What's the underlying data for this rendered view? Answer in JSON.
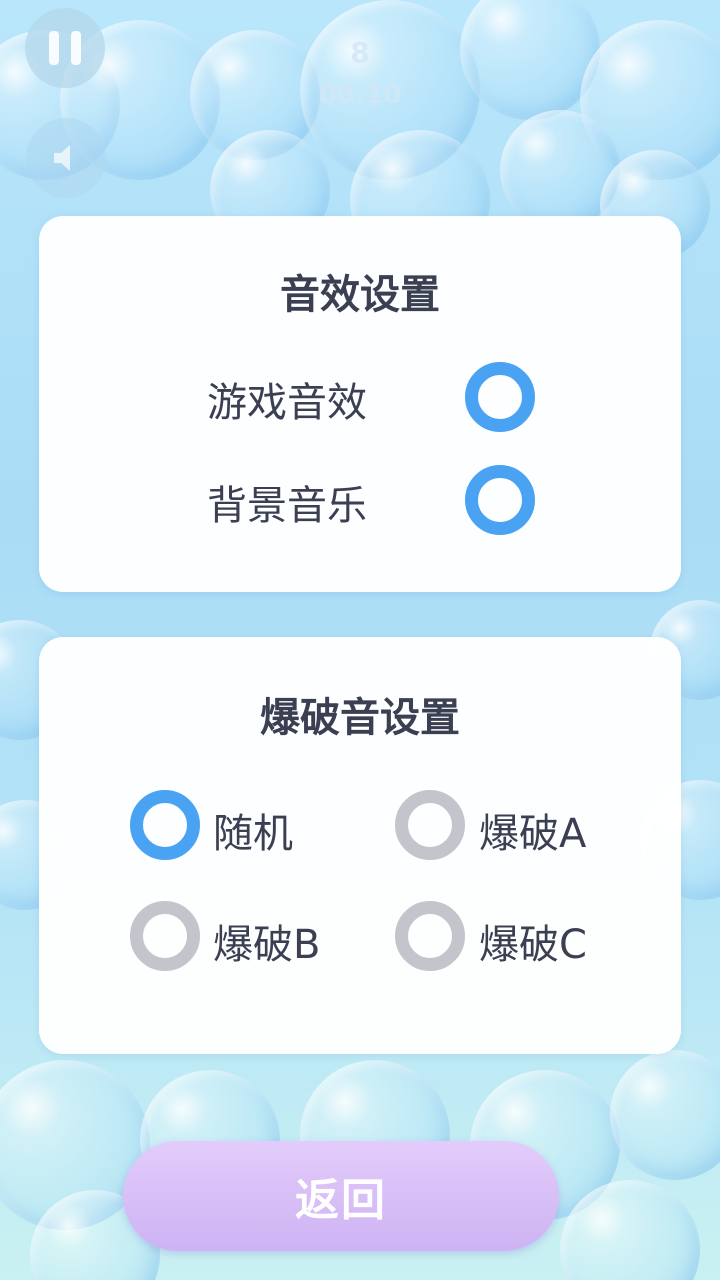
{
  "hud": {
    "score": "8",
    "timer": "00:10"
  },
  "sound_settings": {
    "title": "音效设置",
    "items": [
      {
        "label": "游戏音效",
        "enabled": true
      },
      {
        "label": "背景音乐",
        "enabled": true
      }
    ]
  },
  "pop_settings": {
    "title": "爆破音设置",
    "options": [
      {
        "label": "随机",
        "selected": true
      },
      {
        "label": "爆破A",
        "selected": false
      },
      {
        "label": "爆破B",
        "selected": false
      },
      {
        "label": "爆破C",
        "selected": false
      }
    ]
  },
  "back_button": {
    "label": "返回"
  },
  "colors": {
    "accent": "#4aa3f2",
    "inactive": "#c4c4cc",
    "text": "#3b3f52",
    "button": "#d6bff6"
  }
}
